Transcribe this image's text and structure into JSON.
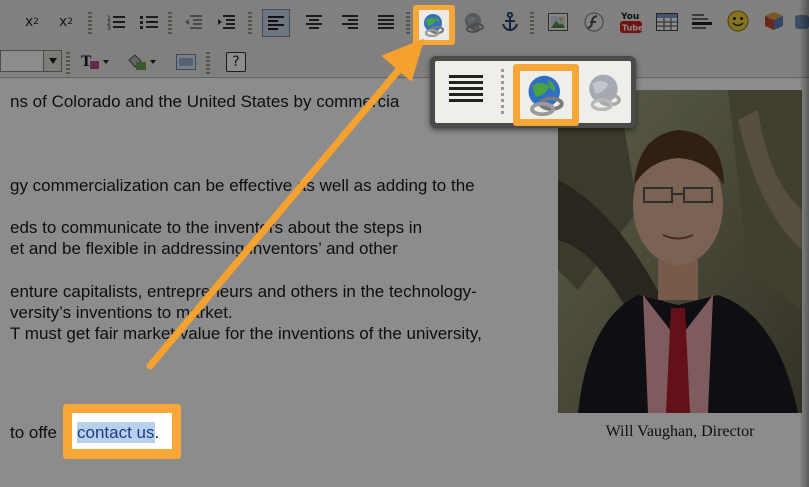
{
  "toolbar": {
    "subscript_label": "x",
    "subscript_mark": "2",
    "superscript_label": "x",
    "superscript_mark": "2",
    "help_label": "?"
  },
  "content": {
    "lines": [
      "ns of Colorado and the United States by commercia",
      "gy commercialization can be effective as well as adding to the",
      "eds to communicate to the inventors about the steps in",
      "et and be flexible in addressing inventors’ and other",
      "enture capitalists, entrepreneurs and others in the technology-",
      "versity’s inventions to market.",
      "T must get fair market value for the inventions of the university,"
    ],
    "last_line_prefix": "to offe",
    "link_text": "contact us",
    "link_suffix": "."
  },
  "photo": {
    "caption": "Will Vaughan, Director"
  },
  "colors": {
    "highlight": "#f7a738",
    "popup_border": "#4a4a4a",
    "selection": "#b9d0ea"
  },
  "icons": {
    "insert_link": "globe-link-icon",
    "remove_link": "globe-unlink-icon",
    "anchor": "anchor-icon",
    "image": "image-icon",
    "flash": "flash-icon",
    "youtube": "youtube-icon",
    "table": "table-icon",
    "horizontal_rule": "horizontal-rule-icon",
    "emoticon": "smiley-icon",
    "special_char": "cube-icon"
  }
}
